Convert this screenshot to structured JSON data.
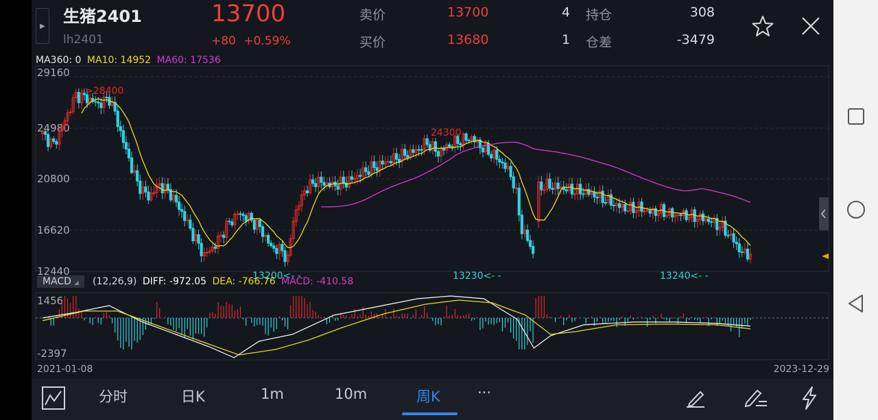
{
  "header": {
    "name": "生猪2401",
    "code": "lh2401",
    "price": "13700",
    "change": "+80",
    "change_pct": "+0.59%",
    "ask_label": "卖价",
    "ask_price": "13700",
    "ask_vol": "4",
    "bid_label": "买价",
    "bid_price": "13680",
    "bid_vol": "1",
    "oi_label": "持仓",
    "oi_value": "308",
    "oi_diff_label": "仓差",
    "oi_diff_value": "-3479"
  },
  "ma_legend": {
    "ma360": "MA360: 0",
    "ma10": "MA10: 14952",
    "ma60": "MA60: 17536"
  },
  "macd_legend": {
    "tag": "MACD",
    "params": "(12,26,9)",
    "diff": "DIFF: -972.05",
    "dea": "DEA: -766.76",
    "macd": "MACD: -410.58"
  },
  "chart_data": {
    "type": "candlestick",
    "y_ticks": [
      "29160",
      "24980",
      "20800",
      "16620",
      "12440"
    ],
    "macd_ticks": [
      "1456",
      "-2397"
    ],
    "annotations": [
      {
        "text": "->28400"
      },
      {
        "text": "24300"
      },
      {
        "text": "13200<- -"
      },
      {
        "text": "13230<- -"
      },
      {
        "text": "13240<- -"
      }
    ],
    "date_start": "2021-01-08",
    "date_end": "2023-12-29",
    "ylim": [
      12440,
      29160
    ],
    "colors": {
      "up": "#e02a2a",
      "down": "#2ed3e0",
      "ma10": "#ecdc2c",
      "ma60": "#d63ad6",
      "diff": "#ffffff",
      "dea": "#ecdc2c"
    }
  },
  "tabs": {
    "fenshi": "分时",
    "rik": "日K",
    "m1": "1m",
    "m10": "10m",
    "zhouk": "周K",
    "more": "···"
  },
  "icons": {
    "chart_type": "chart-toggle-icon",
    "draw": "draw-line-icon",
    "edit": "edit-icon",
    "flash": "lightning-icon",
    "star": "star-icon",
    "close": "close-icon"
  }
}
